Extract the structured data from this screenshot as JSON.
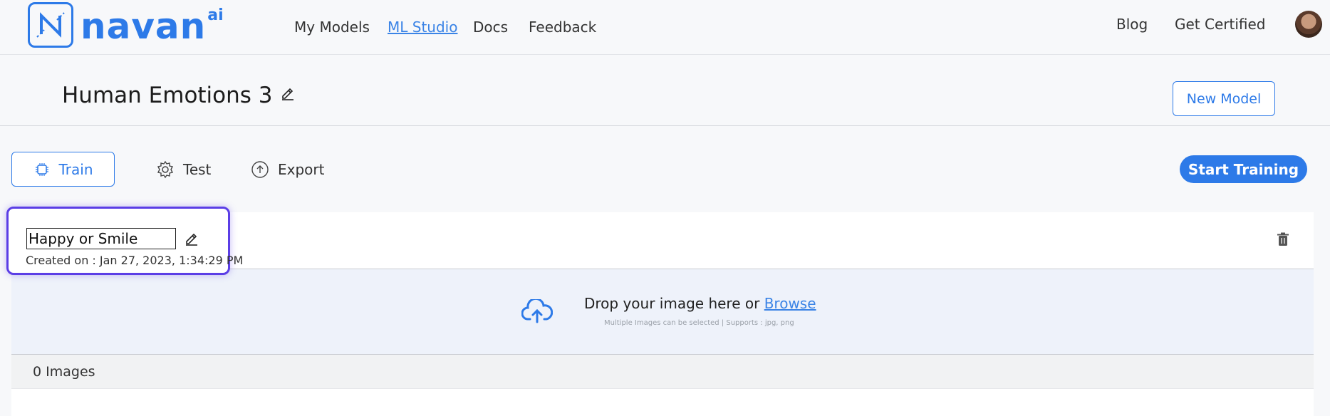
{
  "nav": {
    "brand": "navan",
    "brand_sup": "ai",
    "links": [
      "My Models",
      "ML Studio",
      "Docs",
      "Feedback"
    ],
    "right_links": [
      "Blog",
      "Get Certified"
    ]
  },
  "header": {
    "title": "Human Emotions 3",
    "new_model_label": "New Model"
  },
  "tabs": [
    {
      "label": "Train",
      "icon": "chip-icon"
    },
    {
      "label": "Test",
      "icon": "gear-icon"
    },
    {
      "label": "Export",
      "icon": "upload-circle-icon"
    }
  ],
  "start_training_label": "Start Training",
  "class_card": {
    "name": "Happy or Smile",
    "created": "Created on : Jan 27, 2023, 1:34:29 PM",
    "drop_text": "Drop your image here or ",
    "browse_label": "Browse",
    "drop_subtext": "Multiple Images can be selected | Supports : jpg, png",
    "image_count": "0 Images"
  },
  "colors": {
    "accent": "#2d7ae8",
    "highlight": "#5b3ee6",
    "dropzone_bg": "#eef2fa"
  }
}
